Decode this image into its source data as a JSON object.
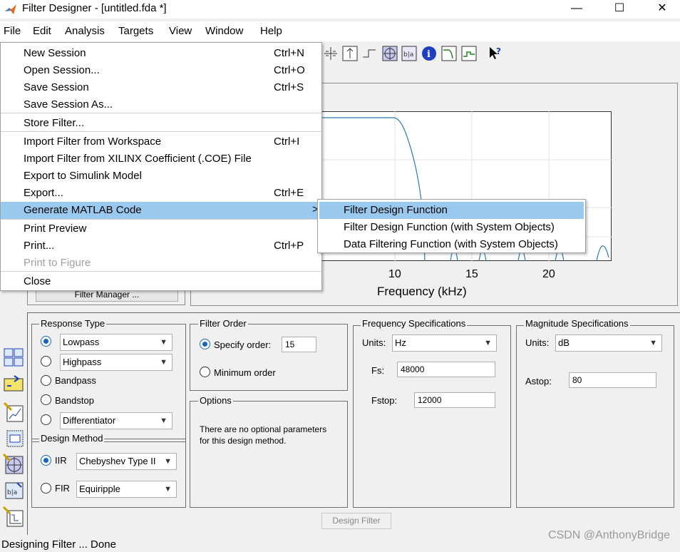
{
  "window": {
    "title": "Filter Designer -  [untitled.fda *]",
    "minimize": "—",
    "maximize": "☐",
    "close": "✕"
  },
  "menubar": [
    "File",
    "Edit",
    "Analysis",
    "Targets",
    "View",
    "Window",
    "Help"
  ],
  "file_menu": {
    "items": [
      {
        "label": "New Session",
        "shortcut": "Ctrl+N"
      },
      {
        "label": "Open Session...",
        "shortcut": "Ctrl+O"
      },
      {
        "label": "Save Session",
        "shortcut": "Ctrl+S"
      },
      {
        "label": "Save Session As...",
        "shortcut": ""
      },
      {
        "label": "Store Filter...",
        "shortcut": ""
      },
      {
        "label": "Import Filter from Workspace",
        "shortcut": "Ctrl+I"
      },
      {
        "label": "Import Filter from XILINX Coefficient (.COE) File",
        "shortcut": ""
      },
      {
        "label": "Export to Simulink Model",
        "shortcut": ""
      },
      {
        "label": "Export...",
        "shortcut": "Ctrl+E"
      },
      {
        "label": "Generate MATLAB Code",
        "shortcut": "",
        "submenu_arrow": ">"
      },
      {
        "label": "Print Preview",
        "shortcut": ""
      },
      {
        "label": "Print...",
        "shortcut": "Ctrl+P"
      },
      {
        "label": "Print to Figure",
        "shortcut": "",
        "disabled": true
      },
      {
        "label": "Close",
        "shortcut": ""
      }
    ]
  },
  "generate_submenu": [
    "Filter Design Function",
    "Filter Design Function (with System Objects)",
    "Data Filtering Function (with System Objects)"
  ],
  "plot": {
    "x_ticks": [
      "10",
      "15",
      "20"
    ],
    "xlabel": "Frequency (kHz)",
    "filter_manager_label": "Filter Manager ..."
  },
  "response_type": {
    "title": "Response Type",
    "lowpass": "Lowpass",
    "highpass": "Highpass",
    "bandpass": "Bandpass",
    "bandstop": "Bandstop",
    "differentiator": "Differentiator"
  },
  "design_method": {
    "title": "Design Method",
    "iir_label": "IIR",
    "iir_value": "Chebyshev Type II",
    "fir_label": "FIR",
    "fir_value": "Equiripple"
  },
  "filter_order": {
    "title": "Filter Order",
    "specify_label": "Specify order:",
    "specify_value": "15",
    "minimum_label": "Minimum order"
  },
  "options": {
    "title": "Options",
    "text_line1": "There are no optional parameters",
    "text_line2": "for this design method."
  },
  "frequency_specs": {
    "title": "Frequency Specifications",
    "units_label": "Units:",
    "units_value": "Hz",
    "fs_label": "Fs:",
    "fs_value": "48000",
    "fstop_label": "Fstop:",
    "fstop_value": "12000"
  },
  "magnitude_specs": {
    "title": "Magnitude Specifications",
    "units_label": "Units:",
    "units_value": "dB",
    "astop_label": "Astop:",
    "astop_value": "80"
  },
  "design_button": "Design Filter",
  "status": "Designing Filter ... Done",
  "watermark": "CSDN @AnthonyBridge",
  "colors": {
    "highlight": "#99c9ef",
    "radio_selected": "#1565c0",
    "curve": "#2b7bb9"
  }
}
